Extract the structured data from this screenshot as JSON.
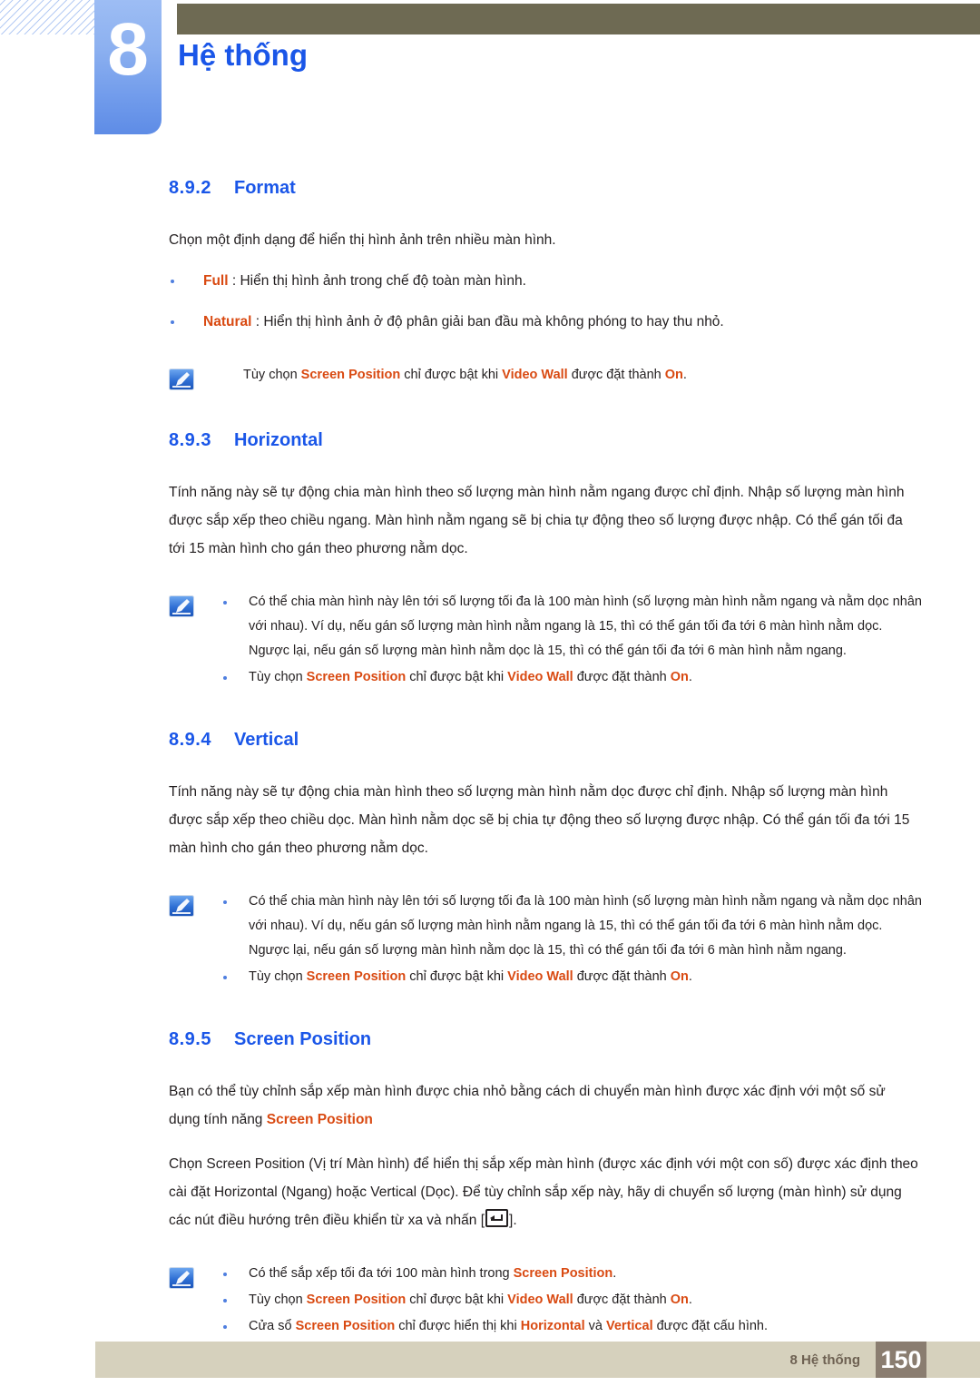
{
  "header": {
    "chapter_number": "8",
    "chapter_title": "Hệ thống",
    "bar_color": "#6e6a53",
    "tab_color": "#7fa3ee",
    "title_color": "#1a56e8"
  },
  "colors": {
    "heading_blue": "#1a56e8",
    "keyword_orange": "#d94a12",
    "bullet_blue": "#4f7fe0",
    "footer_bar": "#d6d1bd",
    "footer_page_box": "#8a7d70"
  },
  "sections": {
    "format": {
      "number": "8.9.2",
      "title": "Format",
      "intro": "Chọn một định dạng để hiển thị hình ảnh trên nhiều màn hình.",
      "items": [
        {
          "term": "Full",
          "rest": " : Hiển thị hình ảnh trong chế độ toàn màn hình."
        },
        {
          "term": "Natural",
          "rest": " : Hiển thị hình ảnh ở độ phân giải ban đầu mà không phóng to hay thu nhỏ."
        }
      ],
      "note": {
        "icon": "note-pencil-icon",
        "pre": "Tùy chọn ",
        "kw1": "Screen Position",
        "mid": " chỉ được bật khi ",
        "kw2": "Video Wall",
        "mid2": " được đặt thành ",
        "kw3": "On",
        "end": "."
      }
    },
    "horizontal": {
      "number": "8.9.3",
      "title": "Horizontal",
      "paragraph": "Tính năng này sẽ tự động chia màn hình theo số lượng màn hình nằm ngang được chỉ định. Nhập số lượng màn hình được sắp xếp theo chiều ngang. Màn hình nằm ngang sẽ bị chia tự động theo số lượng được nhập. Có thể gán tối đa tới 15 màn hình cho gán theo phương nằm dọc.",
      "note": {
        "icon": "note-pencil-icon",
        "bullet1": "Có thể chia màn hình này lên tới số lượng tối đa là 100 màn hình (số lượng màn hình nằm ngang và nằm dọc nhân với nhau). Ví dụ, nếu gán số lượng màn hình nằm ngang là 15, thì có thể gán tối đa tới 6 màn hình nằm dọc. Ngược lại, nếu gán số lượng màn hình nằm dọc là 15, thì có thể gán tối đa tới 6 màn hình nằm ngang.",
        "bullet2": {
          "pre": "Tùy chọn ",
          "kw1": "Screen Position",
          "mid": " chỉ được bật khi ",
          "kw2": "Video Wall",
          "mid2": " được đặt thành ",
          "kw3": "On",
          "end": "."
        }
      }
    },
    "vertical": {
      "number": "8.9.4",
      "title": "Vertical",
      "paragraph": "Tính năng này sẽ tự động chia màn hình theo số lượng màn hình nằm dọc được chỉ định. Nhập số lượng màn hình được sắp xếp theo chiều dọc. Màn hình nằm dọc sẽ bị chia tự động theo số lượng được nhập. Có thể gán tối đa tới 15 màn hình cho gán theo phương nằm dọc.",
      "note": {
        "icon": "note-pencil-icon",
        "bullet1": "Có thể chia màn hình này lên tới số lượng tối đa là 100 màn hình (số lượng màn hình nằm ngang và nằm dọc nhân với nhau). Ví dụ, nếu gán số lượng màn hình nằm ngang là 15, thì có thể gán tối đa tới 6 màn hình nằm dọc. Ngược lại, nếu gán số lượng màn hình nằm dọc là 15, thì có thể gán tối đa tới 6 màn hình nằm ngang.",
        "bullet2": {
          "pre": "Tùy chọn ",
          "kw1": "Screen Position",
          "mid": " chỉ được bật khi ",
          "kw2": "Video Wall",
          "mid2": " được đặt thành ",
          "kw3": "On",
          "end": "."
        }
      }
    },
    "screen_position": {
      "number": "8.9.5",
      "title": "Screen Position",
      "para1_pre": "Bạn có thể tùy chỉnh sắp xếp màn hình được chia nhỏ bằng cách di chuyển màn hình được xác định với một số sử dụng tính năng ",
      "para1_kw": "Screen Position",
      "para2_pre": "Chọn Screen Position (Vị trí Màn hình) để hiển thị sắp xếp màn hình (được xác định với một con số) được xác định theo cài đặt Horizontal (Ngang) hoặc Vertical (Dọc). Để tùy chỉnh sắp xếp này, hãy di chuyển số lượng (màn hình) sử dụng các nút điều hướng trên điều khiển từ xa và nhấn [",
      "para2_key": "enter-key-icon",
      "para2_post": "].",
      "note": {
        "icon": "note-pencil-icon",
        "bullet1": {
          "pre": "Có thể sắp xếp tối đa tới 100 màn hình trong ",
          "kw1": "Screen Position",
          "end": "."
        },
        "bullet2": {
          "pre": "Tùy chọn ",
          "kw1": "Screen Position",
          "mid": " chỉ được bật khi ",
          "kw2": "Video Wall",
          "mid2": " được đặt thành ",
          "kw3": "On",
          "end": "."
        },
        "bullet3": {
          "pre": "Cửa sổ ",
          "kw1": "Screen Position",
          "mid": " chỉ được hiển thị khi ",
          "kw2": "Horizontal",
          "mid2": " và ",
          "kw3": "Vertical",
          "end": " được đặt cấu hình."
        }
      }
    }
  },
  "footer": {
    "label": "8 Hệ thống",
    "page_number": "150"
  }
}
